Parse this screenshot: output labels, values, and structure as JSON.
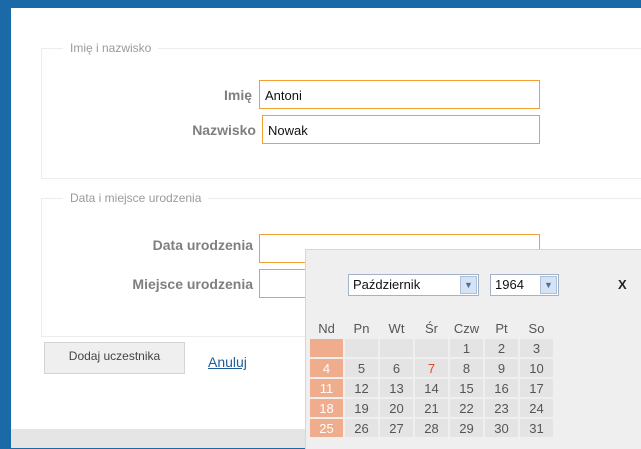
{
  "personal_section": {
    "legend": "Imię i nazwisko",
    "first_name_label": "Imię",
    "first_name_value": "Antoni",
    "last_name_label": "Nazwisko",
    "last_name_value": "Nowak"
  },
  "birth_section": {
    "legend": "Data i miejsce urodzenia",
    "date_label": "Data urodzenia",
    "date_value": "",
    "place_label": "Miejsce urodzenia",
    "place_value": ""
  },
  "actions": {
    "add_label": "Dodaj uczestnika",
    "cancel_label": "Anuluj"
  },
  "calendar": {
    "month": "Październik",
    "year": "1964",
    "close": "X",
    "weekdays": [
      "Nd",
      "Pn",
      "Wt",
      "Śr",
      "Czw",
      "Pt",
      "So"
    ],
    "weeks": [
      [
        "",
        "",
        "",
        "",
        "1",
        "2",
        "3"
      ],
      [
        "4",
        "5",
        "6",
        "7",
        "8",
        "9",
        "10"
      ],
      [
        "11",
        "12",
        "13",
        "14",
        "15",
        "16",
        "17"
      ],
      [
        "18",
        "19",
        "20",
        "21",
        "22",
        "23",
        "24"
      ],
      [
        "25",
        "26",
        "27",
        "28",
        "29",
        "30",
        "31"
      ]
    ],
    "highlighted_day": "7"
  },
  "colors": {
    "frame_blue": "#1a6aa8",
    "input_border": "#f2a032",
    "sunday_bg": "#efad8d",
    "today_text": "#e0471f",
    "link": "#1e5d97"
  }
}
